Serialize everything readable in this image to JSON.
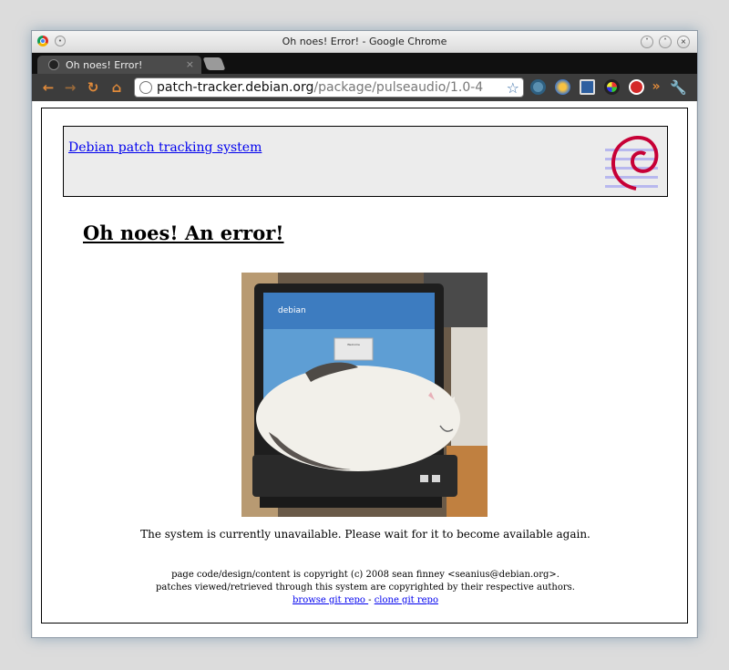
{
  "window": {
    "title": "Oh noes! Error! - Google Chrome"
  },
  "tab": {
    "label": "Oh noes! Error!",
    "close": "×"
  },
  "toolbar": {
    "back": "←",
    "forward": "→",
    "reload": "↻",
    "home": "⌂",
    "url_host": "patch-tracker.debian.org",
    "url_path": "/package/pulseaudio/1.0-4",
    "bookmark_star": "☆",
    "more": "»"
  },
  "page": {
    "header_link": "Debian patch tracking system",
    "error_title": "Oh noes! An error!",
    "status_message": "The system is currently unavailable. Please wait for it to become available again.",
    "footer_copyright": "page code/design/content is copyright (c) 2008 sean finney <seanius@debian.org>.",
    "footer_patches": "patches viewed/retrieved through this system are copyrighted by their respective authors.",
    "browse_link": "browse git repo ",
    "link_separator": " - ",
    "clone_link": "clone git repo",
    "photo_screen_text": "debian",
    "photo_dialog_text": "Welcome"
  },
  "colors": {
    "link": "#0000ee",
    "debian_red": "#c70036",
    "toolbar_bg": "#3c3c3c",
    "tab_bg": "#4b4b4b"
  }
}
